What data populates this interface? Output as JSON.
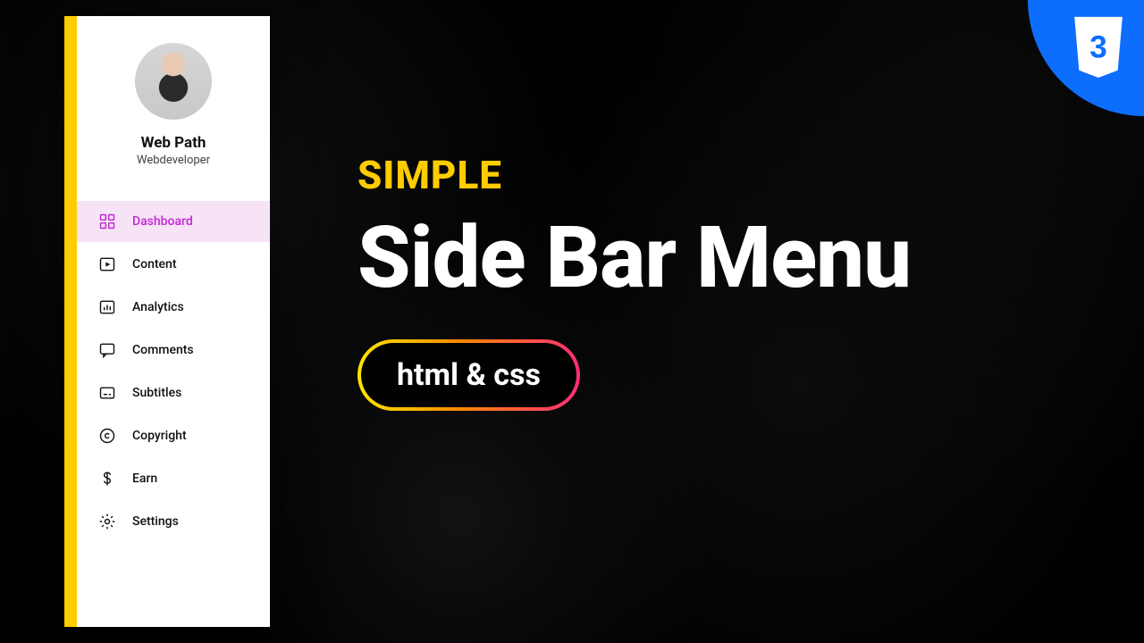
{
  "sidebar": {
    "profile": {
      "name": "Web Path",
      "role": "Webdeveloper"
    },
    "items": [
      {
        "label": "Dashboard",
        "icon": "dashboard-icon",
        "active": true
      },
      {
        "label": "Content",
        "icon": "content-icon",
        "active": false
      },
      {
        "label": "Analytics",
        "icon": "analytics-icon",
        "active": false
      },
      {
        "label": "Comments",
        "icon": "comments-icon",
        "active": false
      },
      {
        "label": "Subtitles",
        "icon": "subtitles-icon",
        "active": false
      },
      {
        "label": "Copyright",
        "icon": "copyright-icon",
        "active": false
      },
      {
        "label": "Earn",
        "icon": "earn-icon",
        "active": false
      },
      {
        "label": "Settings",
        "icon": "settings-icon",
        "active": false
      }
    ]
  },
  "title": {
    "kicker": "SIMPLE",
    "heading": "Side Bar Menu",
    "pill": "html & css"
  },
  "badge": {
    "label": "3"
  },
  "colors": {
    "accent_yellow": "#ffcc00",
    "active_bg": "#f6e3f6",
    "active_fg": "#c026d3",
    "badge_blue": "#0d6efd"
  }
}
